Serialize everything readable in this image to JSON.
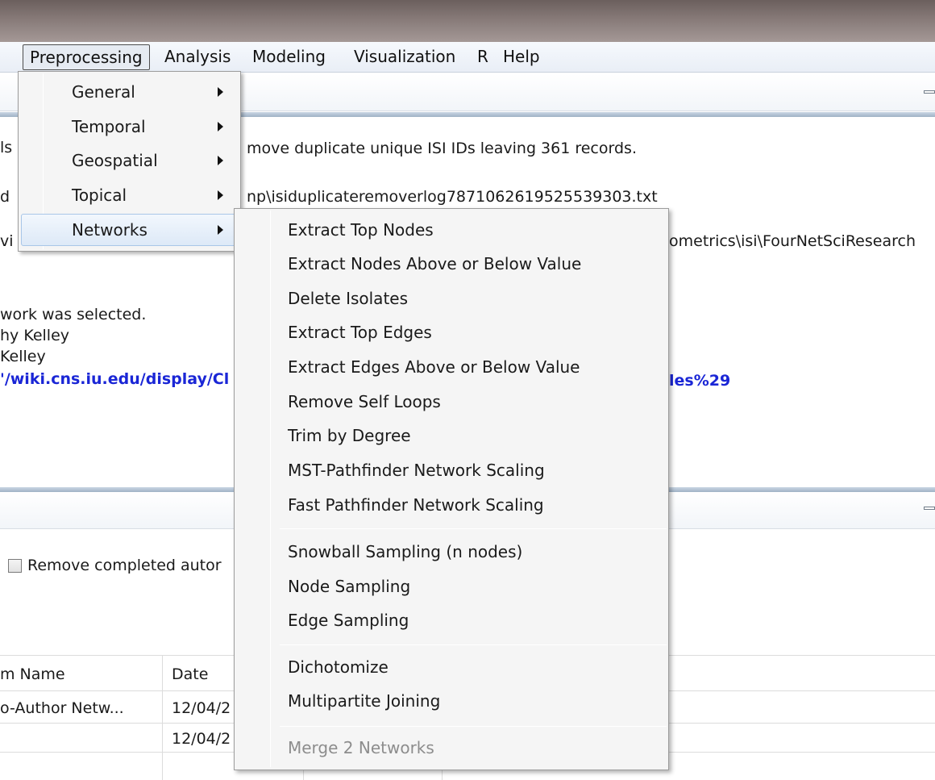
{
  "menubar": {
    "items": [
      {
        "label": "Preprocessing"
      },
      {
        "label": "Analysis"
      },
      {
        "label": "Modeling"
      },
      {
        "label": "Visualization"
      },
      {
        "label": "R"
      },
      {
        "label": "Help"
      }
    ]
  },
  "preprocessing_menu": {
    "items": [
      {
        "label": "General"
      },
      {
        "label": "Temporal"
      },
      {
        "label": "Geospatial"
      },
      {
        "label": "Topical"
      },
      {
        "label": "Networks"
      }
    ]
  },
  "networks_submenu": {
    "items": [
      {
        "label": "Extract Top Nodes"
      },
      {
        "label": "Extract Nodes Above or Below Value"
      },
      {
        "label": "Delete Isolates"
      },
      {
        "label": "Extract Top Edges"
      },
      {
        "label": "Extract Edges Above or Below Value"
      },
      {
        "label": "Remove Self Loops"
      },
      {
        "label": "Trim by Degree"
      },
      {
        "label": "MST-Pathfinder Network Scaling"
      },
      {
        "label": "Fast Pathfinder Network Scaling"
      },
      {
        "label": "Snowball Sampling (n nodes)"
      },
      {
        "label": "Node Sampling"
      },
      {
        "label": "Edge Sampling"
      },
      {
        "label": "Dichotomize"
      },
      {
        "label": "Multipartite Joining"
      },
      {
        "label": "Merge 2 Networks"
      }
    ]
  },
  "console": {
    "line1_left": "ls",
    "line1_right": "move duplicate unique ISI IDs leaving 361 records.",
    "line2_left": "d",
    "line2_right": "np\\isiduplicateremoverlog7871062619525539303.txt",
    "line3_left": "vi",
    "line3_right": "ometrics\\isi\\FourNetSciResearch",
    "line4": "work was selected.",
    "line5": "hy Kelley",
    "line6": "Kelley",
    "link_left": "'/wiki.cns.iu.edu/display/Cl",
    "link_right": "les%29"
  },
  "scheduler": {
    "remove_completed_label": "Remove completed autor"
  },
  "table": {
    "headers": [
      "m Name",
      "Date"
    ],
    "rows": [
      {
        "name": "o-Author Netw...",
        "date": "12/04/2"
      },
      {
        "name": "",
        "date": "12/04/2"
      }
    ]
  }
}
